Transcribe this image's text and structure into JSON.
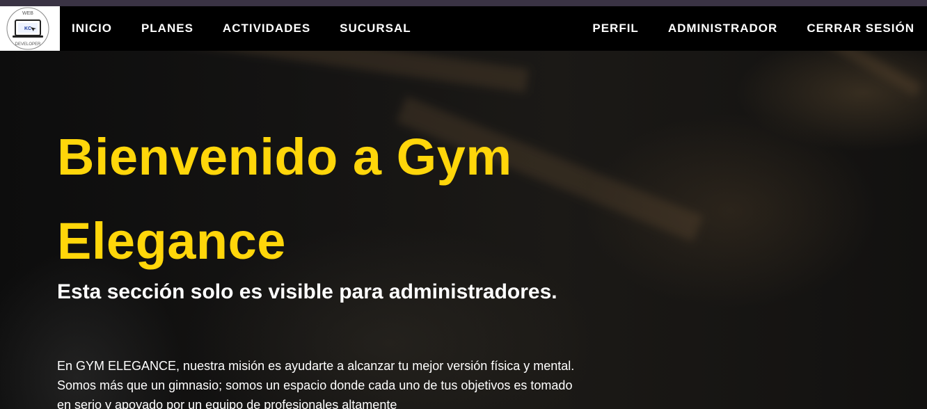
{
  "nav": {
    "logo": {
      "top_text": "WEB",
      "bottom_text": "DEVELOPER",
      "screen_text": "KC",
      "icon": "laptop-logo-icon"
    },
    "left_links": [
      "INICIO",
      "PLANES",
      "ACTIVIDADES",
      "SUCURSAL"
    ],
    "right_links": [
      "PERFIL",
      "ADMINISTRADOR",
      "CERRAR SESIÓN"
    ]
  },
  "hero": {
    "title": "Bienvenido a Gym Elegance",
    "subtitle": "Esta sección solo es visible para administradores.",
    "paragraph": "En GYM ELEGANCE, nuestra misión es ayudarte a alcanzar tu mejor versión física y mental. Somos más que un gimnasio; somos un espacio donde cada uno de tus objetivos es tomado en serio y apoyado por un equipo de profesionales altamente"
  },
  "colors": {
    "accent": "#ffd60a",
    "nav_bg": "#000000",
    "text": "#ffffff"
  }
}
